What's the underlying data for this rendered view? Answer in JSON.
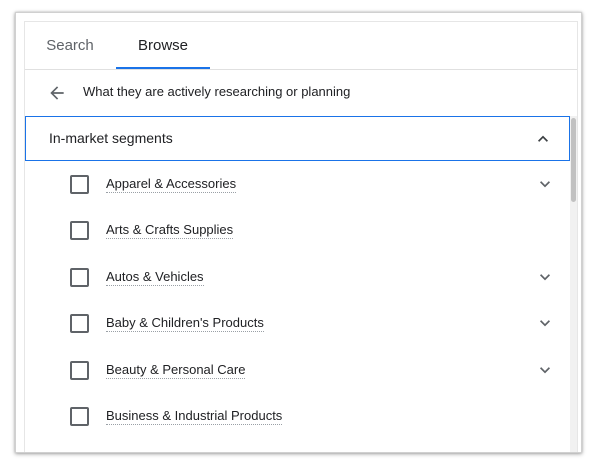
{
  "tabs": {
    "search_label": "Search",
    "browse_label": "Browse",
    "active": "Browse"
  },
  "breadcrumb": {
    "back_icon": "arrow-left-icon",
    "text": "What they are actively researching or planning"
  },
  "section": {
    "title": "In-market segments",
    "expanded": true,
    "toggle_icon": "chevron-up-icon"
  },
  "segments": [
    {
      "label": "Apparel & Accessories",
      "checked": false,
      "expandable": true
    },
    {
      "label": "Arts & Crafts Supplies",
      "checked": false,
      "expandable": false
    },
    {
      "label": "Autos & Vehicles",
      "checked": false,
      "expandable": true
    },
    {
      "label": "Baby & Children's Products",
      "checked": false,
      "expandable": true
    },
    {
      "label": "Beauty & Personal Care",
      "checked": false,
      "expandable": true
    },
    {
      "label": "Business & Industrial Products",
      "checked": false,
      "expandable": false
    }
  ],
  "colors": {
    "accent": "#1a73e8",
    "text_primary": "#202124",
    "text_secondary": "#5f6368",
    "divider": "#e0e0e0"
  }
}
